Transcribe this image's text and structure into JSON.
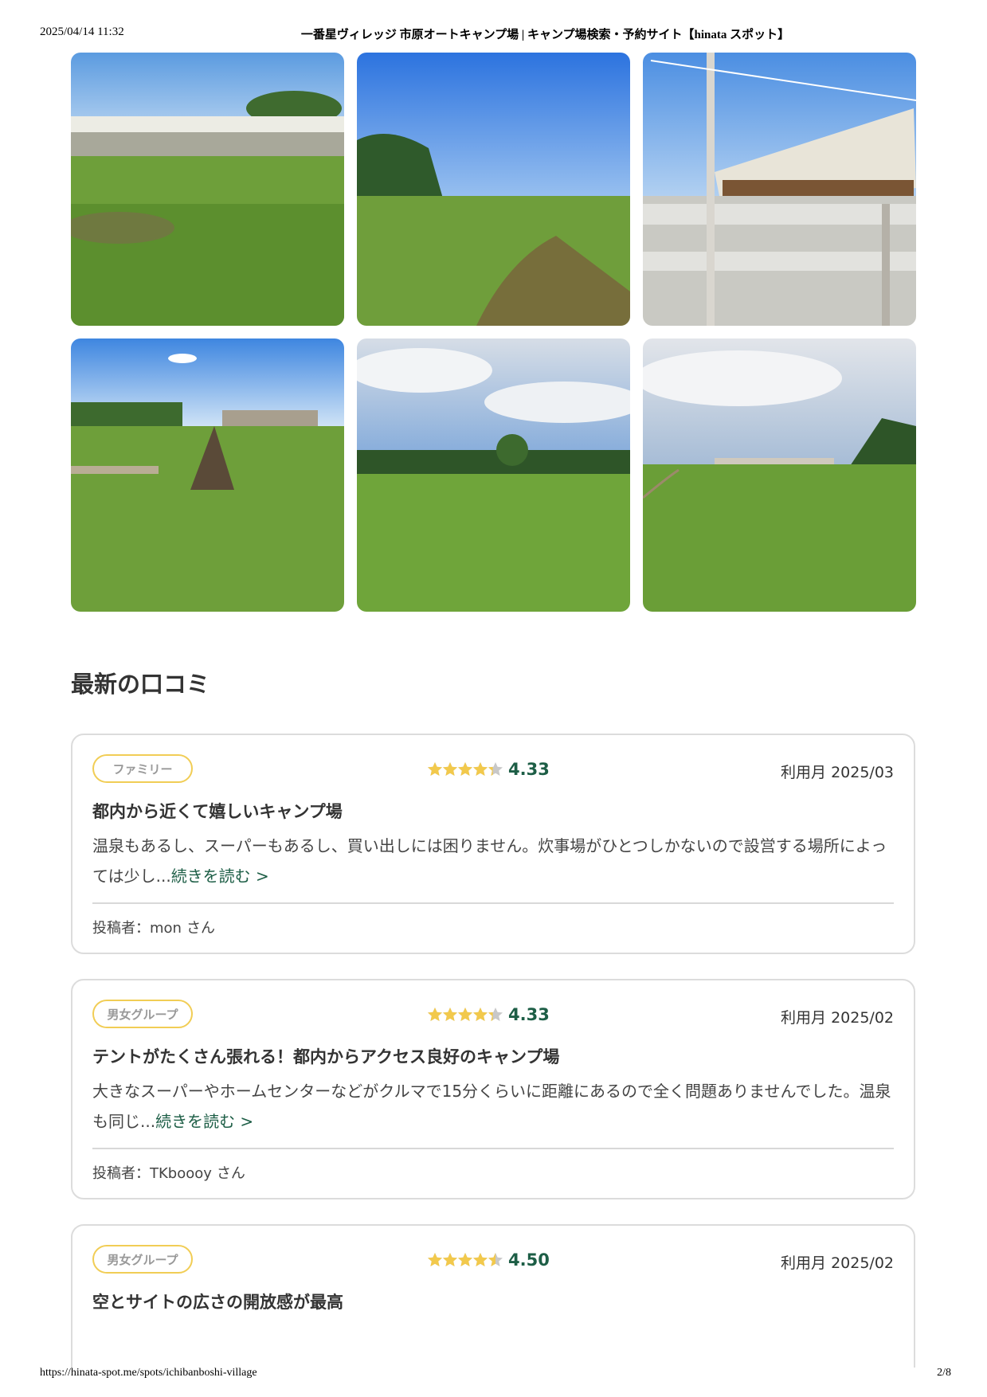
{
  "print_header": {
    "datetime": "2025/04/14 11:32",
    "page_title": "一番星ヴィレッジ 市原オートキャンプ場 | キャンプ場検索・予約サイト【hinata スポット】"
  },
  "print_footer": {
    "url": "https://hinata-spot.me/spots/ichibanboshi-village",
    "page_number": "2/8"
  },
  "gallery": {
    "photos": [
      {
        "subject": "grass-field-with-white-tent-canopy"
      },
      {
        "subject": "open-grass-field-blue-sky"
      },
      {
        "subject": "wooden-deck-with-bunting"
      },
      {
        "subject": "campfire-wood-stack-on-grass"
      },
      {
        "subject": "wide-grass-field-cloudy-sky"
      },
      {
        "subject": "grass-field-with-distant-building"
      }
    ]
  },
  "reviews_section": {
    "title": "最新の口コミ",
    "reviews": [
      {
        "tag": "ファミリー",
        "rating": 4.33,
        "rating_text": "4.33",
        "usage_label": "利用月",
        "usage_month": "2025/03",
        "title": "都内から近くて嬉しいキャンプ場",
        "body": "温泉もあるし、スーパーもあるし、買い出しには困りません。炊事場がひとつしかないので設営する場所によっては少し...",
        "more_label": "続きを読む >",
        "poster_label": "投稿者：mon",
        "poster_suffix": "さん"
      },
      {
        "tag": "男女グループ",
        "rating": 4.33,
        "rating_text": "4.33",
        "usage_label": "利用月",
        "usage_month": "2025/02",
        "title": "テントがたくさん張れる！都内からアクセス良好のキャンプ場",
        "body": "大きなスーパーやホームセンターなどがクルマで15分くらいに距離にあるので全く問題ありませんでした。温泉も同じ...",
        "more_label": "続きを読む >",
        "poster_label": "投稿者：TKboooy",
        "poster_suffix": "さん"
      },
      {
        "tag": "男女グループ",
        "rating": 4.5,
        "rating_text": "4.50",
        "usage_label": "利用月",
        "usage_month": "2025/02",
        "title": "空とサイトの広さの開放感が最高"
      }
    ]
  },
  "colors": {
    "accent_green": "#1d5e46",
    "tag_border": "#f1cd55",
    "star_filled": "#f2c94c",
    "star_empty": "#c8c8c8"
  }
}
